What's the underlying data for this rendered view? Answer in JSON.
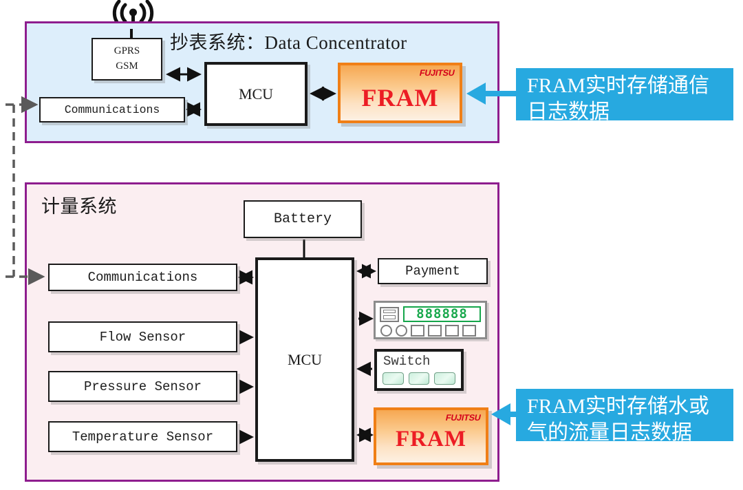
{
  "diagram": {
    "top_panel": {
      "title": "抄表系统：Data Concentrator",
      "boxes": {
        "gprs_line1": "GPRS",
        "gprs_line2": "GSM",
        "communications": "Communications",
        "mcu": "MCU",
        "fram": "FRAM",
        "fram_brand": "FUJITSU"
      },
      "callout": {
        "line1": "FRAM实时存储通信",
        "line2": "日志数据"
      }
    },
    "bottom_panel": {
      "title": "计量系统",
      "boxes": {
        "battery": "Battery",
        "communications": "Communications",
        "flow_sensor": "Flow Sensor",
        "pressure_sensor": "Pressure Sensor",
        "temperature_sensor": "Temperature Sensor",
        "mcu": "MCU",
        "payment": "Payment",
        "switch": "Switch",
        "display_digits": "888888",
        "fram": "FRAM",
        "fram_brand": "FUJITSU"
      },
      "callout": {
        "line1": "FRAM实时存储水或",
        "line2": "气的流量日志数据"
      }
    },
    "icons": {
      "antenna": "antenna-wireless-icon",
      "display": "lcd-display-icon",
      "switch_buttons": "switch-button-icon"
    },
    "colors": {
      "panel_border": "#8e1d8e",
      "panel_top_fill": "#ddeefb",
      "panel_bottom_fill": "#fbeef1",
      "fram_border": "#f07f16",
      "fram_text": "#ec1c24",
      "callout_bg": "#27a9e0",
      "callout_arrow": "#27a9e0",
      "lcd_green": "#18a84c",
      "dashed_link": "#5a5a5a"
    }
  }
}
